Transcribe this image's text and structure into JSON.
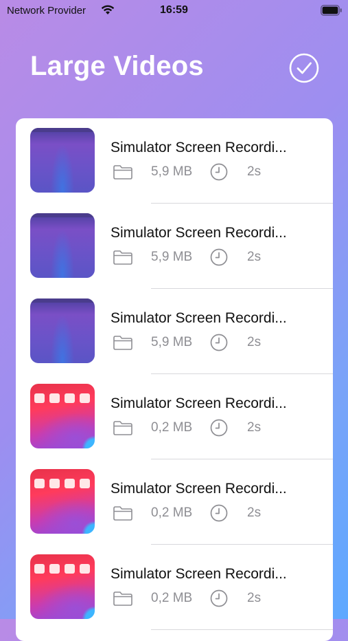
{
  "status_bar": {
    "carrier": "Network Provider",
    "time": "16:59",
    "wifi_icon": "wifi-icon",
    "battery_icon": "battery-icon"
  },
  "header": {
    "title": "Large Videos",
    "done_icon": "checkmark-circle-icon"
  },
  "videos": [
    {
      "title": "Simulator Screen Recordi...",
      "size": "5,9 MB",
      "duration": "2s",
      "thumbnail": "purple-gradient"
    },
    {
      "title": "Simulator Screen Recordi...",
      "size": "5,9 MB",
      "duration": "2s",
      "thumbnail": "purple-gradient"
    },
    {
      "title": "Simulator Screen Recordi...",
      "size": "5,9 MB",
      "duration": "2s",
      "thumbnail": "purple-gradient"
    },
    {
      "title": "Simulator Screen Recordi...",
      "size": "0,2 MB",
      "duration": "2s",
      "thumbnail": "home-screen"
    },
    {
      "title": "Simulator Screen Recordi...",
      "size": "0,2 MB",
      "duration": "2s",
      "thumbnail": "home-screen"
    },
    {
      "title": "Simulator Screen Recordi...",
      "size": "0,2 MB",
      "duration": "2s",
      "thumbnail": "home-screen"
    }
  ],
  "icons": {
    "size": "folder-icon",
    "duration": "clock-icon"
  },
  "colors": {
    "title": "#ffffff",
    "row_title": "#111111",
    "meta_text": "#8e8e93",
    "card_background": "#ffffff"
  }
}
